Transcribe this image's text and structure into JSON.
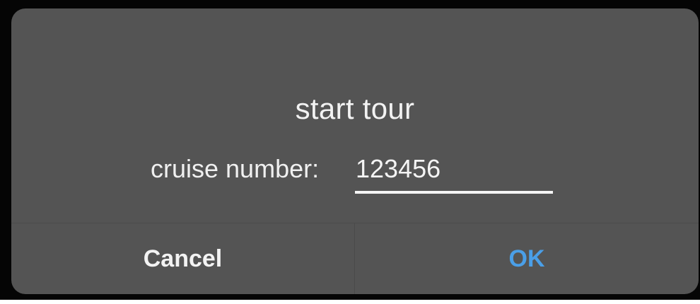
{
  "dialog": {
    "title": "start tour",
    "field": {
      "label": "cruise number:",
      "value": "123456"
    },
    "buttons": {
      "cancel_label": "Cancel",
      "ok_label": "OK"
    },
    "colors": {
      "background": "#545454",
      "text": "#f2f2f2",
      "accent": "#4a9fe8",
      "frame": "#050505"
    }
  }
}
